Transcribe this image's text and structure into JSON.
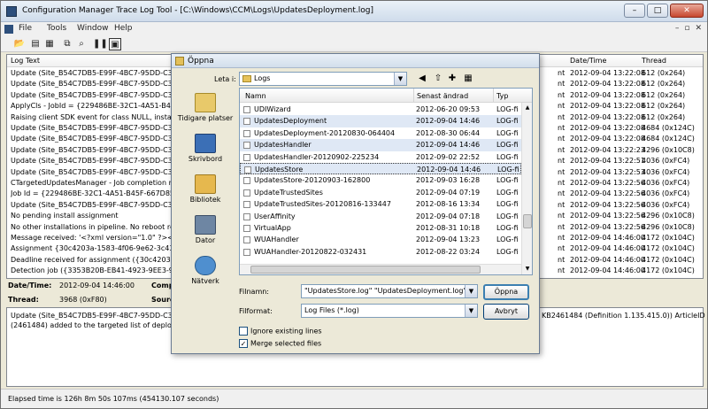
{
  "window": {
    "title": "Configuration Manager Trace Log Tool - [C:\\Windows\\CCM\\Logs\\UpdatesDeployment.log]"
  },
  "menu": [
    "File",
    "Tools",
    "Window",
    "Help"
  ],
  "grid": {
    "headers": [
      "Log Text",
      "Date/Time",
      "Thread"
    ],
    "rows": [
      {
        "text": "Update (Site_B54C7DB5-E99F-4BC7-95DD-C383A9",
        "comp": "nt",
        "time": "2012-09-04 13:22:08",
        "thread": "612 (0x264)"
      },
      {
        "text": "Update (Site_B54C7DB5-E99F-4BC7-95DD-C383A9",
        "comp": "nt",
        "time": "2012-09-04 13:22:08",
        "thread": "612 (0x264)"
      },
      {
        "text": "Update (Site_B54C7DB5-E99F-4BC7-95DD-C383A9",
        "comp": "nt",
        "time": "2012-09-04 13:22:08",
        "thread": "612 (0x264)"
      },
      {
        "text": "ApplyCls - JobId = {229486BE-32C1-4A51-B45F-667",
        "comp": "nt",
        "time": "2012-09-04 13:22:08",
        "thread": "612 (0x264)"
      },
      {
        "text": "Raising client SDK event for class NULL, instance N",
        "comp": "nt",
        "time": "2012-09-04 13:22:08",
        "thread": "612 (0x264)"
      },
      {
        "text": "Update (Site_B54C7DB5-E99F-4BC7-95DD-C383A9",
        "comp": "nt",
        "time": "2012-09-04 13:22:08",
        "thread": "4684 (0x124C)"
      },
      {
        "text": "Update (Site_B54C7DB5-E99F-4BC7-95DD-C383A9",
        "comp": "nt",
        "time": "2012-09-04 13:22:08",
        "thread": "4684 (0x124C)"
      },
      {
        "text": "Update (Site_B54C7DB5-E99F-4BC7-95DD-C383A9",
        "comp": "nt",
        "time": "2012-09-04 13:22:23",
        "thread": "4296 (0x10C8)"
      },
      {
        "text": "Update (Site_B54C7DB5-E99F-4BC7-95DD-C383A9",
        "comp": "nt",
        "time": "2012-09-04 13:22:51",
        "thread": "4036 (0xFC4)"
      },
      {
        "text": "Update (Site_B54C7DB5-E99F-4BC7-95DD-C383A9",
        "comp": "nt",
        "time": "2012-09-04 13:22:53",
        "thread": "4036 (0xFC4)"
      },
      {
        "text": "CTargetedUpdatesManager - Job completion receive",
        "comp": "nt",
        "time": "2012-09-04 13:22:56",
        "thread": "4036 (0xFC4)"
      },
      {
        "text": "Job Id = {229486BE-32C1-4A51-B45F-667D852C15",
        "comp": "nt",
        "time": "2012-09-04 13:22:56",
        "thread": "4036 (0xFC4)"
      },
      {
        "text": "Update (Site_B54C7DB5-E99F-4BC7-95DD-C383A9",
        "comp": "nt",
        "time": "2012-09-04 13:22:56",
        "thread": "4036 (0xFC4)"
      },
      {
        "text": "No pending install assignment",
        "comp": "nt",
        "time": "2012-09-04 13:22:56",
        "thread": "4296 (0x10C8)"
      },
      {
        "text": "No other installations in pipeline. No reboot required.",
        "comp": "nt",
        "time": "2012-09-04 13:22:56",
        "thread": "4296 (0x10C8)"
      },
      {
        "text": "Message received: '<?xml version=\"1.0\" ?><CIAssign",
        "comp": "nt",
        "time": "2012-09-04 14:46:00",
        "thread": "4172 (0x104C)"
      },
      {
        "text": "Assignment {30c4203a-1583-4f06-9e62-3c43e0aab3",
        "comp": "nt",
        "time": "2012-09-04 14:46:00",
        "thread": "4172 (0x104C)"
      },
      {
        "text": "Deadline received for assignment ({30c4203a-1583-",
        "comp": "nt",
        "time": "2012-09-04 14:46:00",
        "thread": "4172 (0x104C)"
      },
      {
        "text": "Detection job ({3353B20B-EB41-4923-9EE3-9E4206",
        "comp": "nt",
        "time": "2012-09-04 14:46:00",
        "thread": "4172 (0x104C)"
      }
    ]
  },
  "details": {
    "datetime_label": "Date/Time:",
    "datetime_value": "2012-09-04 14:46:00",
    "component_label": "Compo",
    "thread_label": "Thread:",
    "thread_value": "3968 (0xF80)",
    "source_label": "Sourc",
    "message_line1": "Update (Site_B54C7DB5-E99F-4BC7-95DD-C383A9",
    "message_line2": "(2461484) added to the targeted list of deploymen",
    "message_right": "KB2461484 (Definition 1.135.415.0)) ArticleID"
  },
  "status": "Elapsed time is 126h 8m 50s 107ms (454130.107 seconds)",
  "dialog": {
    "title": "Öppna",
    "lookin_label": "Leta i:",
    "lookin_value": "Logs",
    "places": [
      "Tidigare platser",
      "Skrivbord",
      "Bibliotek",
      "Dator",
      "Nätverk"
    ],
    "columns": [
      "Namn",
      "Senast ändrad",
      "Typ"
    ],
    "files": [
      {
        "name": "UDIWizard",
        "date": "2012-06-20 09:53",
        "type": "LOG-fi"
      },
      {
        "name": "UpdatesDeployment",
        "date": "2012-09-04 14:46",
        "type": "LOG-fi"
      },
      {
        "name": "UpdatesDeployment-20120830-064404",
        "date": "2012-08-30 06:44",
        "type": "LOG-fi"
      },
      {
        "name": "UpdatesHandler",
        "date": "2012-09-04 14:46",
        "type": "LOG-fi"
      },
      {
        "name": "UpdatesHandler-20120902-225234",
        "date": "2012-09-02 22:52",
        "type": "LOG-fi"
      },
      {
        "name": "UpdatesStore",
        "date": "2012-09-04 14:46",
        "type": "LOG-fi"
      },
      {
        "name": "UpdatesStore-20120903-162800",
        "date": "2012-09-03 16:28",
        "type": "LOG-fi"
      },
      {
        "name": "UpdateTrustedSites",
        "date": "2012-09-04 07:19",
        "type": "LOG-fi"
      },
      {
        "name": "UpdateTrustedSites-20120816-133447",
        "date": "2012-08-16 13:34",
        "type": "LOG-fi"
      },
      {
        "name": "UserAffinity",
        "date": "2012-09-04 07:18",
        "type": "LOG-fi"
      },
      {
        "name": "VirtualApp",
        "date": "2012-08-31 10:18",
        "type": "LOG-fi"
      },
      {
        "name": "WUAHandler",
        "date": "2012-09-04 13:23",
        "type": "LOG-fi"
      },
      {
        "name": "WUAHandler-20120822-032431",
        "date": "2012-08-22 03:24",
        "type": "LOG-fi"
      }
    ],
    "filename_label": "Filnamn:",
    "filename_value": "\"UpdatesStore.log\" \"UpdatesDeployment.log\" \"Upda",
    "filetype_label": "Filformat:",
    "filetype_value": "Log Files (*.log)",
    "open_label": "Öppna",
    "cancel_label": "Avbryt",
    "ignore_label": "Ignore existing lines",
    "merge_label": "Merge selected files"
  }
}
